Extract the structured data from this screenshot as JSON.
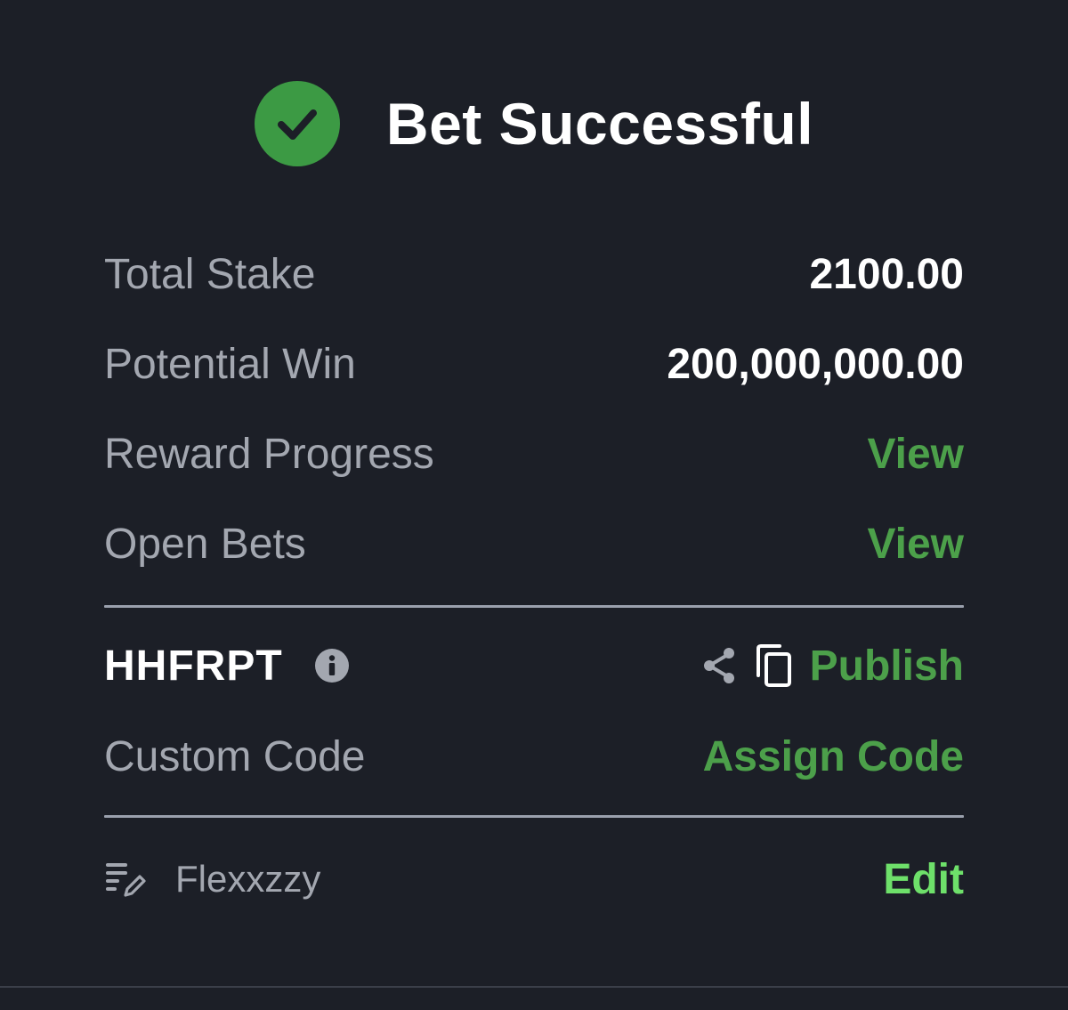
{
  "header": {
    "title": "Bet Successful",
    "icon": "check-circle-icon",
    "icon_color": "#3c9a44"
  },
  "summary": {
    "total_stake_label": "Total Stake",
    "total_stake_value": "2100.00",
    "potential_win_label": "Potential Win",
    "potential_win_value": "200,000,000.00",
    "reward_progress_label": "Reward Progress",
    "reward_progress_link": "View",
    "open_bets_label": "Open Bets",
    "open_bets_link": "View"
  },
  "booking": {
    "code": "HHFRPT",
    "publish_label": "Publish",
    "custom_code_label": "Custom Code",
    "assign_code_label": "Assign Code"
  },
  "note": {
    "name": "Flexxzzy",
    "edit_label": "Edit"
  },
  "colors": {
    "background": "#1c1f27",
    "accent_green": "#4ca04a",
    "bright_green": "#6ee06a",
    "muted_text": "#a3a7b0"
  }
}
